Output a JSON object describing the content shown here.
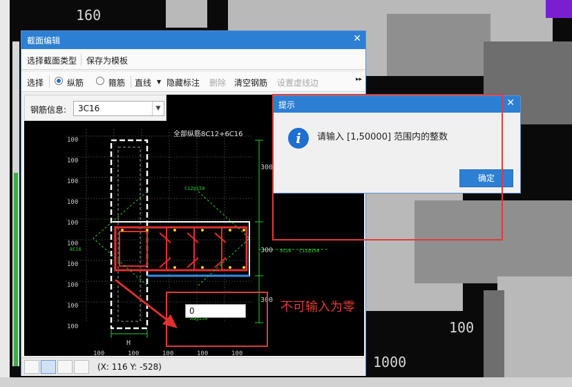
{
  "editor": {
    "title": "截面编辑",
    "menu": [
      "选择截面类型",
      "保存为模板"
    ],
    "toolbar": {
      "select": "选择",
      "longitudinal": "纵筋",
      "stirrup": "箍筋",
      "line": "直线",
      "hide_labels": "隐藏标注",
      "delete": "删除",
      "clear_rebar": "清空钢筋",
      "set_dashed": "设置虚线边"
    },
    "rebar_info_label": "钢筋信息:",
    "rebar_info_value": "3C16",
    "canvas_label_top": "全部纵筋8C12+6C16",
    "coord_readout": "(X: 116 Y: -528)",
    "dim_labels": {
      "col_100": "100",
      "h_300": "300",
      "stirrup_top": "C12@150",
      "stirrup_right": "C12@150",
      "stirrup_bottom": "A6@150",
      "left_tag": "8C16",
      "right_tag": "3C16",
      "bottom_h": "H"
    },
    "input_value": "0"
  },
  "hint": {
    "title": "提示",
    "message": "请输入 [1,50000] 范围内的整数",
    "ok": "确定"
  },
  "annotation": "不可输入为零",
  "background": {
    "label_a": "160",
    "label_b": "1000",
    "label_c": "100"
  },
  "colors": {
    "accent": "#2d7fd3",
    "annotation_red": "#e23a3a",
    "rebar_red": "#e03030",
    "dim_green": "#29d12b"
  }
}
